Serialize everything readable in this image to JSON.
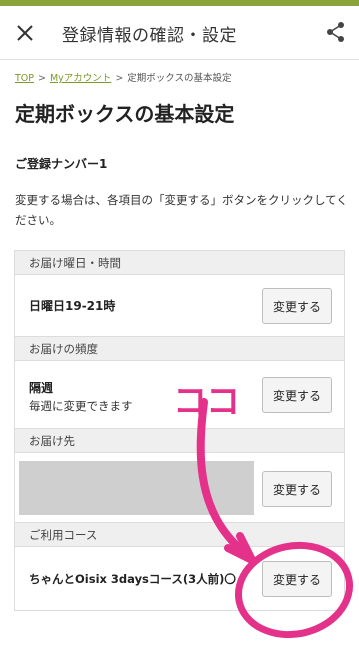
{
  "header": {
    "title": "登録情報の確認・設定",
    "close_icon": "close-icon",
    "share_icon": "share-icon"
  },
  "breadcrumb": {
    "items": [
      "TOP",
      "Myアカウント",
      "定期ボックスの基本設定"
    ],
    "separator": ">"
  },
  "page": {
    "title": "定期ボックスの基本設定",
    "registration_number": "ご登録ナンバー1",
    "instructions": "変更する場合は、各項目の「変更する」ボタンをクリックしてください。"
  },
  "sections": [
    {
      "header": "お届け曜日・時間",
      "value": "日曜日19-21時",
      "button": "変更する"
    },
    {
      "header": "お届けの頻度",
      "value": "隔週",
      "sub_value": "毎週に変更できます",
      "button": "変更する"
    },
    {
      "header": "お届け先",
      "value": "",
      "button": "変更する"
    },
    {
      "header": "ご利用コース",
      "value": "ちゃんとOisix 3daysコース(3人前)〇",
      "button": "変更する"
    }
  ],
  "annotation": {
    "label": "ココ",
    "color": "#e4318a"
  },
  "colors": {
    "accent_green": "#8aa43a",
    "link_green": "#7a9a2a"
  }
}
